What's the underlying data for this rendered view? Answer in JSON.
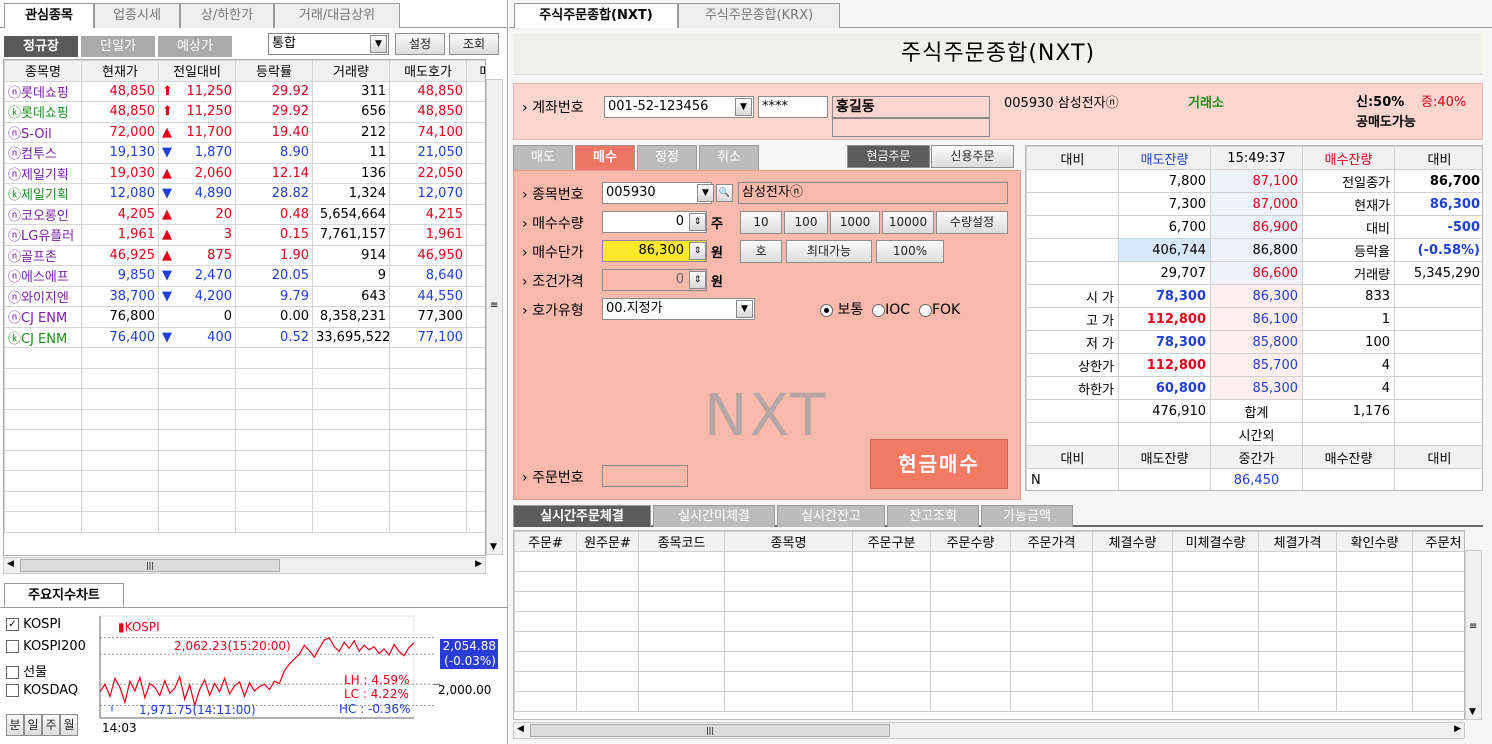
{
  "left_tabs": [
    "관심종목",
    "업종시세",
    "상/하한가",
    "거래/대금상위"
  ],
  "market_tabs": [
    "정규장",
    "단일가",
    "예상가"
  ],
  "market_select": "통합",
  "btn_settings": "설정",
  "btn_lookup": "조회",
  "watch_headers": [
    "종목명",
    "현재가",
    "전일대비",
    "등락률",
    "거래량",
    "매도호가",
    "매"
  ],
  "watch_rows": [
    {
      "name": "ⓝ롯데쇼핑",
      "price": "48,850",
      "dir": "⬆",
      "change": "11,250",
      "rate": "29.92",
      "vol": "311",
      "ask": "48,850",
      "color": "red"
    },
    {
      "name": "ⓚ롯데쇼핑",
      "price": "48,850",
      "dir": "⬆",
      "change": "11,250",
      "rate": "29.92",
      "vol": "656",
      "ask": "48,850",
      "color": "red"
    },
    {
      "name": "ⓝS-Oil",
      "price": "72,000",
      "dir": "▲",
      "change": "11,700",
      "rate": "19.40",
      "vol": "212",
      "ask": "74,100",
      "color": "red"
    },
    {
      "name": "ⓝ컴투스",
      "price": "19,130",
      "dir": "▼",
      "change": "1,870",
      "rate": "8.90",
      "vol": "11",
      "ask": "21,050",
      "color": "blue"
    },
    {
      "name": "ⓝ제일기획",
      "price": "19,030",
      "dir": "▲",
      "change": "2,060",
      "rate": "12.14",
      "vol": "136",
      "ask": "22,050",
      "color": "red"
    },
    {
      "name": "ⓚ제일기획",
      "price": "12,080",
      "dir": "▼",
      "change": "4,890",
      "rate": "28.82",
      "vol": "1,324",
      "ask": "12,070",
      "color": "blue"
    },
    {
      "name": "ⓝ코오롱인",
      "price": "4,205",
      "dir": "▲",
      "change": "20",
      "rate": "0.48",
      "vol": "5,654,664",
      "ask": "4,215",
      "color": "red"
    },
    {
      "name": "ⓝLG유플러",
      "price": "1,961",
      "dir": "▲",
      "change": "3",
      "rate": "0.15",
      "vol": "7,761,157",
      "ask": "1,961",
      "color": "red"
    },
    {
      "name": "ⓝ골프존",
      "price": "46,925",
      "dir": "▲",
      "change": "875",
      "rate": "1.90",
      "vol": "914",
      "ask": "46,950",
      "color": "red"
    },
    {
      "name": "ⓝ에스에프",
      "price": "9,850",
      "dir": "▼",
      "change": "2,470",
      "rate": "20.05",
      "vol": "9",
      "ask": "8,640",
      "color": "blue"
    },
    {
      "name": "ⓝ와이지엔",
      "price": "38,700",
      "dir": "▼",
      "change": "4,200",
      "rate": "9.79",
      "vol": "643",
      "ask": "44,550",
      "color": "blue"
    },
    {
      "name": "ⓝCJ ENM",
      "price": "76,800",
      "dir": "",
      "change": "0",
      "rate": "0.00",
      "vol": "8,358,231",
      "ask": "77,300",
      "color": "black"
    },
    {
      "name": "ⓚCJ ENM",
      "price": "76,400",
      "dir": "▼",
      "change": "400",
      "rate": "0.52",
      "vol": "33,695,522",
      "ask": "77,100",
      "color": "blue"
    }
  ],
  "chart_tab": "주요지수차트",
  "index_checks": [
    {
      "label": "KOSPI",
      "checked": true
    },
    {
      "label": "KOSPI200",
      "checked": false
    },
    {
      "label": "선물",
      "checked": false
    },
    {
      "label": "KOSDAQ",
      "checked": false
    }
  ],
  "period_buttons": [
    "분",
    "일",
    "주",
    "월"
  ],
  "chart_data": {
    "type": "line",
    "legend": "KOSPI",
    "high_label": "2,062.23(15:20:00)",
    "low_label": "1,971.75(14:11:00)",
    "current_value": "2,054.88",
    "current_change": "(-0.03%)",
    "y_tick": "2,000.00",
    "x_tick": "14:03",
    "lh": "LH :  4.59%",
    "lc": "LC :  4.22%",
    "hc": "HC : -0.36%",
    "ylim": [
      1955,
      2075
    ],
    "values": [
      1990,
      2000,
      1984,
      2008,
      1996,
      1976,
      2004,
      1991,
      2009,
      1982,
      2001,
      1996,
      1985,
      2005,
      1988,
      1995,
      2010,
      1980,
      1999,
      1972,
      1993,
      2006,
      1985,
      2001,
      1990,
      2008,
      1987,
      1998,
      2003,
      1984,
      2002,
      1991,
      1997,
      2000,
      1993,
      2004,
      2001,
      2018,
      2027,
      2034,
      2040,
      2052,
      2045,
      2036,
      2048,
      2059,
      2062,
      2050,
      2044,
      2056,
      2048,
      2058,
      2044,
      2052,
      2046,
      2050,
      2041,
      2047,
      2039,
      2053,
      2044,
      2038,
      2049,
      2055
    ]
  },
  "right_tabs": [
    "주식주문종합(NXT)",
    "주식주문종합(KRX)"
  ],
  "page_title": "주식주문종합(NXT)",
  "account": {
    "label": "계좌번호",
    "number": "001-52-123456",
    "password": "****",
    "name": "홍길동",
    "stock_info": "005930 삼성전자ⓝ",
    "exchange": "거래소",
    "credit": "신:50%",
    "margin": "증:40%",
    "short": "공매도가능"
  },
  "order_tabs": [
    "매도",
    "매수",
    "정정",
    "취소"
  ],
  "order_type_tabs": [
    "현금주문",
    "신용주문"
  ],
  "form": {
    "code_label": "종목번호",
    "code": "005930",
    "code_name": "삼성전자ⓝ",
    "qty_label": "매수수량",
    "qty": "0",
    "qty_unit": "주",
    "qty_buttons": [
      "10",
      "100",
      "1000",
      "10000",
      "수량설정"
    ],
    "price_label": "매수단가",
    "price": "86,300",
    "price_unit": "원",
    "hoga_btn": "호",
    "max_btn": "최대가능",
    "pct_btn": "100%",
    "cond_label": "조건가격",
    "cond": "0",
    "cond_unit": "원",
    "type_label": "호가유형",
    "type": "00.지정가",
    "radios": [
      "보통",
      "IOC",
      "FOK"
    ],
    "watermark": "NXT",
    "order_no_label": "주문번호",
    "submit": "현금매수"
  },
  "orderbook": {
    "headers": [
      "대비",
      "매도잔량",
      "15:49:37",
      "매수잔량",
      "대비"
    ],
    "ask_rows": [
      {
        "qty": "7,800",
        "price": "87,100",
        "label": "전일종가",
        "value": "86,700"
      },
      {
        "qty": "7,300",
        "price": "87,000",
        "label": "현재가",
        "value": "86,300"
      },
      {
        "qty": "6,700",
        "price": "86,900",
        "label": "대비",
        "value": "-500"
      },
      {
        "qty": "406,744",
        "price": "86,800",
        "label": "등락율",
        "value": "(-0.58%)"
      },
      {
        "qty": "29,707",
        "price": "86,600",
        "label": "거래량",
        "value": "5,345,290"
      }
    ],
    "bid_rows": [
      {
        "label": "시 가",
        "lv": "78,300",
        "price": "86,300",
        "qty": "833"
      },
      {
        "label": "고 가",
        "lv": "112,800",
        "price": "86,100",
        "qty": "1"
      },
      {
        "label": "저 가",
        "lv": "78,300",
        "price": "85,800",
        "qty": "100"
      },
      {
        "label": "상한가",
        "lv": "112,800",
        "price": "85,700",
        "qty": "4"
      },
      {
        "label": "하한가",
        "lv": "60,800",
        "price": "85,300",
        "qty": "4"
      }
    ],
    "total_ask": "476,910",
    "total_label": "합계",
    "total_bid": "1,176",
    "after_label": "시간외",
    "mid_headers": [
      "대비",
      "매도잔량",
      "중간가",
      "매수잔량",
      "대비"
    ],
    "mid_row": {
      "flag": "N",
      "price": "86,450"
    }
  },
  "bottom_tabs": [
    "실시간주문체결",
    "실시간미체결",
    "실시간잔고",
    "잔고조회",
    "가능금액"
  ],
  "exec_headers": [
    "주문#",
    "원주문#",
    "종목코드",
    "종목명",
    "주문구분",
    "주문수량",
    "주문가격",
    "체결수량",
    "미체결수량",
    "체결가격",
    "확인수량",
    "주문처"
  ]
}
